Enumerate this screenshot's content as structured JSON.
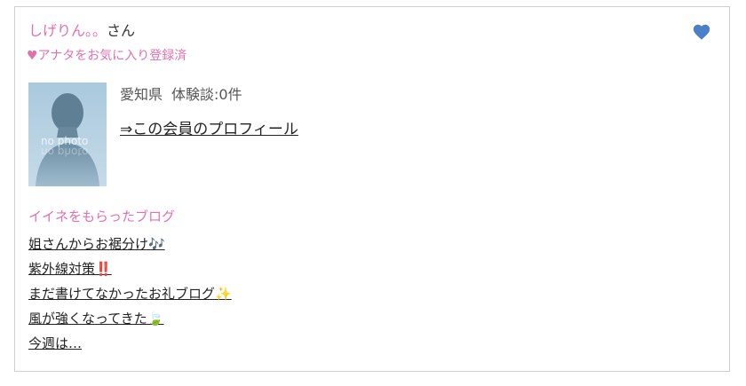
{
  "member": {
    "name": "しげりん。。",
    "honorific": "さん",
    "favorite_status": "♥アナタをお気に入り登録済",
    "prefecture": "愛知県",
    "reviews": "体験談:0件",
    "profile_link": "⇒この会員のプロフィール",
    "avatar_label": "no photo"
  },
  "heart_icon": "heart-icon",
  "colors": {
    "accent_pink": "#e36fae",
    "heart_blue": "#4a7fc9",
    "border": "#cfcfcf"
  },
  "blogs": {
    "heading": "イイネをもらったブログ",
    "items": [
      {
        "title": "姐さんからお裾分け🎶"
      },
      {
        "title": "紫外線対策‼️"
      },
      {
        "title": "まだ書けてなかったお礼ブログ✨"
      },
      {
        "title": "風が強くなってきた🍃"
      },
      {
        "title": "今週は…"
      }
    ]
  }
}
